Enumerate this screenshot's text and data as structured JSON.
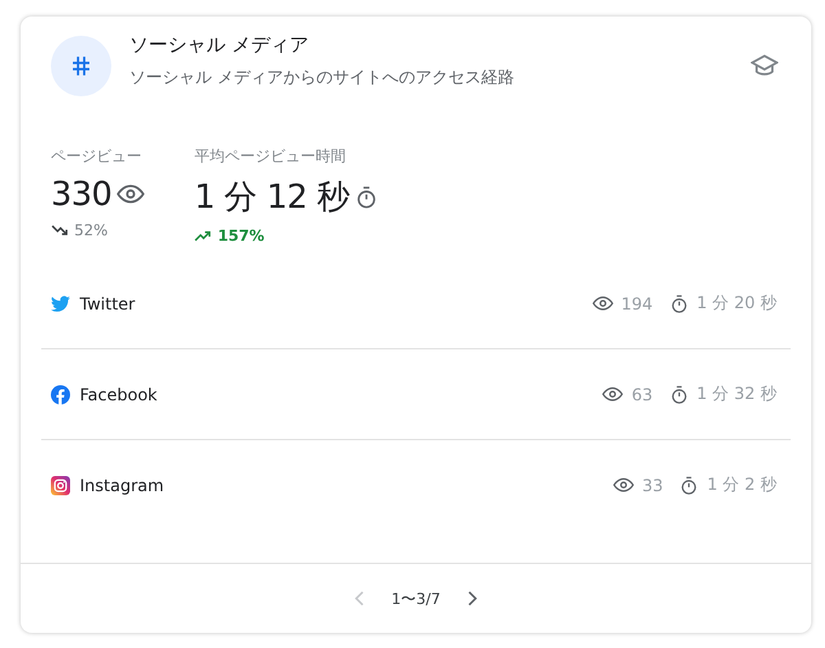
{
  "header": {
    "title": "ソーシャル メディア",
    "subtitle": "ソーシャル メディアからのサイトへのアクセス経路"
  },
  "metrics": [
    {
      "label": "ページビュー",
      "value": "330",
      "kind": "views",
      "rising": false,
      "change": "52%"
    },
    {
      "label": "平均ページビュー時間",
      "value": "1 分 12 秒",
      "kind": "time",
      "rising": true,
      "change": "157%"
    }
  ],
  "sources": [
    {
      "kind": "twitter",
      "name": "Twitter",
      "views": "194",
      "time": "1 分 20 秒"
    },
    {
      "kind": "facebook",
      "name": "Facebook",
      "views": "63",
      "time": "1 分 32 秒"
    },
    {
      "kind": "instagram",
      "name": "Instagram",
      "views": "33",
      "time": "1 分 2 秒"
    }
  ],
  "pagination": {
    "range": "1〜3/7",
    "prev_disabled": true,
    "next_disabled": false
  }
}
